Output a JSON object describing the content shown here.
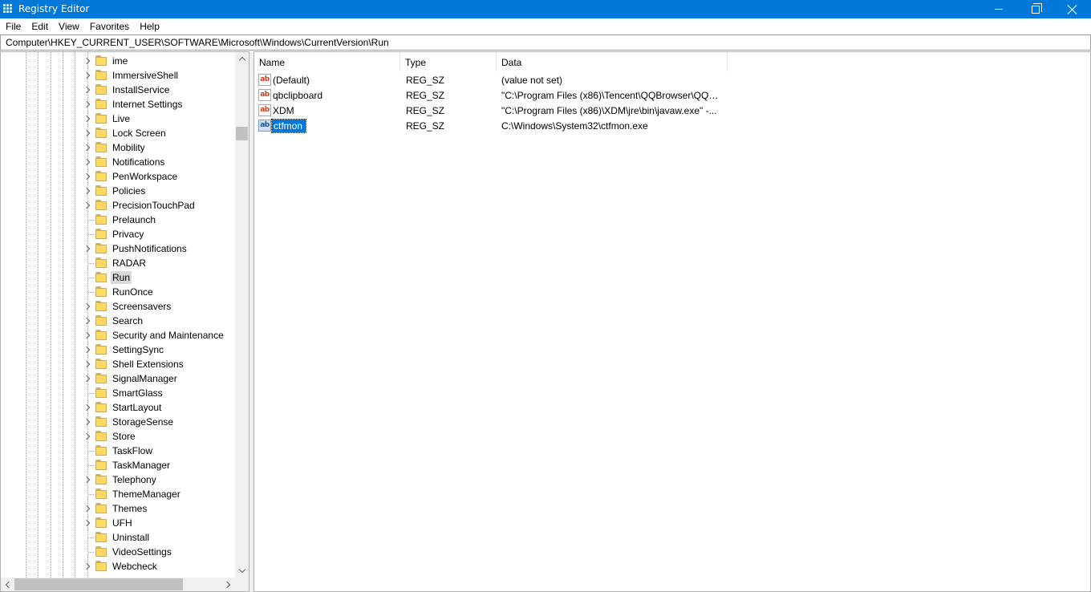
{
  "window": {
    "title": "Registry Editor",
    "icon": "registry-editor-icon"
  },
  "menu": [
    {
      "label": "File"
    },
    {
      "label": "Edit"
    },
    {
      "label": "View"
    },
    {
      "label": "Favorites"
    },
    {
      "label": "Help"
    }
  ],
  "address": {
    "path": "Computer\\HKEY_CURRENT_USER\\SOFTWARE\\Microsoft\\Windows\\CurrentVersion\\Run"
  },
  "tree": {
    "items": [
      {
        "label": "ime",
        "expandable": true
      },
      {
        "label": "ImmersiveShell",
        "expandable": true
      },
      {
        "label": "InstallService",
        "expandable": true
      },
      {
        "label": "Internet Settings",
        "expandable": true
      },
      {
        "label": "Live",
        "expandable": true
      },
      {
        "label": "Lock Screen",
        "expandable": true
      },
      {
        "label": "Mobility",
        "expandable": true
      },
      {
        "label": "Notifications",
        "expandable": true
      },
      {
        "label": "PenWorkspace",
        "expandable": true
      },
      {
        "label": "Policies",
        "expandable": true
      },
      {
        "label": "PrecisionTouchPad",
        "expandable": true
      },
      {
        "label": "Prelaunch",
        "expandable": false
      },
      {
        "label": "Privacy",
        "expandable": false
      },
      {
        "label": "PushNotifications",
        "expandable": true
      },
      {
        "label": "RADAR",
        "expandable": false
      },
      {
        "label": "Run",
        "expandable": false,
        "selected": true
      },
      {
        "label": "RunOnce",
        "expandable": false
      },
      {
        "label": "Screensavers",
        "expandable": true
      },
      {
        "label": "Search",
        "expandable": true
      },
      {
        "label": "Security and Maintenance",
        "expandable": true
      },
      {
        "label": "SettingSync",
        "expandable": true
      },
      {
        "label": "Shell Extensions",
        "expandable": true
      },
      {
        "label": "SignalManager",
        "expandable": true
      },
      {
        "label": "SmartGlass",
        "expandable": false
      },
      {
        "label": "StartLayout",
        "expandable": true
      },
      {
        "label": "StorageSense",
        "expandable": true
      },
      {
        "label": "Store",
        "expandable": true
      },
      {
        "label": "TaskFlow",
        "expandable": false
      },
      {
        "label": "TaskManager",
        "expandable": false
      },
      {
        "label": "Telephony",
        "expandable": true
      },
      {
        "label": "ThemeManager",
        "expandable": false
      },
      {
        "label": "Themes",
        "expandable": true
      },
      {
        "label": "UFH",
        "expandable": true
      },
      {
        "label": "Uninstall",
        "expandable": false
      },
      {
        "label": "VideoSettings",
        "expandable": false
      },
      {
        "label": "Webcheck",
        "expandable": true
      }
    ]
  },
  "list": {
    "columns": [
      {
        "label": "Name"
      },
      {
        "label": "Type"
      },
      {
        "label": "Data"
      }
    ],
    "rows": [
      {
        "name": "(Default)",
        "type": "REG_SZ",
        "data": "(value not set)"
      },
      {
        "name": "qbclipboard",
        "type": "REG_SZ",
        "data": "\"C:\\Program Files (x86)\\Tencent\\QQBrowser\\QQBr..."
      },
      {
        "name": "XDM",
        "type": "REG_SZ",
        "data": "\"C:\\Program Files (x86)\\XDM\\jre\\bin\\javaw.exe\" -..."
      },
      {
        "name": "ctfmon",
        "type": "REG_SZ",
        "data": "C:\\Windows\\System32\\ctfmon.exe",
        "selected": true
      }
    ],
    "value_icon_text": "ab"
  },
  "colors": {
    "titlebar": "#0078d7",
    "selection": "#0078d7",
    "folder": "#ffd966"
  }
}
